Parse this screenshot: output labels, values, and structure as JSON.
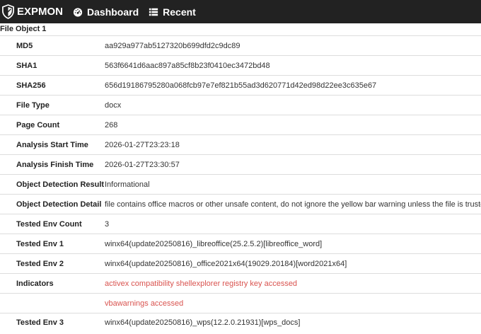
{
  "nav": {
    "brand": "EXPMON",
    "dashboard": "Dashboard",
    "recent": "Recent"
  },
  "section_title": "File Object 1",
  "rows": [
    {
      "key": "MD5",
      "value": "aa929a977ab5127320b699dfd2c9dc89"
    },
    {
      "key": "SHA1",
      "value": "563f6641d6aac897a85cf8b23f0410ec3472bd48"
    },
    {
      "key": "SHA256",
      "value": "656d19186795280a068fcb97e7ef821b55ad3d620771d42ed98d22ee3c635e67"
    },
    {
      "key": "File Type",
      "value": "docx"
    },
    {
      "key": "Page Count",
      "value": "268"
    },
    {
      "key": "Analysis Start Time",
      "value": "2026-01-27T23:23:18"
    },
    {
      "key": "Analysis Finish Time",
      "value": "2026-01-27T23:30:57"
    },
    {
      "key": "Object Detection Result",
      "value": "Informational"
    },
    {
      "key": "Object Detection Detail",
      "value": "file contains office macros or other unsafe content, do not ignore the yellow bar warning unless the file is trusted"
    },
    {
      "key": "Tested Env Count",
      "value": "3"
    },
    {
      "key": "Tested Env 1",
      "value": "winx64(update20250816)_libreoffice(25.2.5.2)[libreoffice_word]"
    },
    {
      "key": "Tested Env 2",
      "value": "winx64(update20250816)_office2021x64(19029.20184)[word2021x64]"
    },
    {
      "key": "Indicators",
      "value": "activex compatibility shellexplorer registry key accessed"
    },
    {
      "key": "",
      "value": "vbawarnings accessed"
    },
    {
      "key": "Tested Env 3",
      "value": "winx64(update20250816)_wps(12.2.0.21931)[wps_docs]"
    }
  ],
  "colors": {
    "navbar": "#222222",
    "indicator": "#d9534f"
  },
  "icons": {
    "brand": "shield-icon",
    "dashboard": "dashboard-gauge-icon",
    "recent": "list-icon"
  }
}
